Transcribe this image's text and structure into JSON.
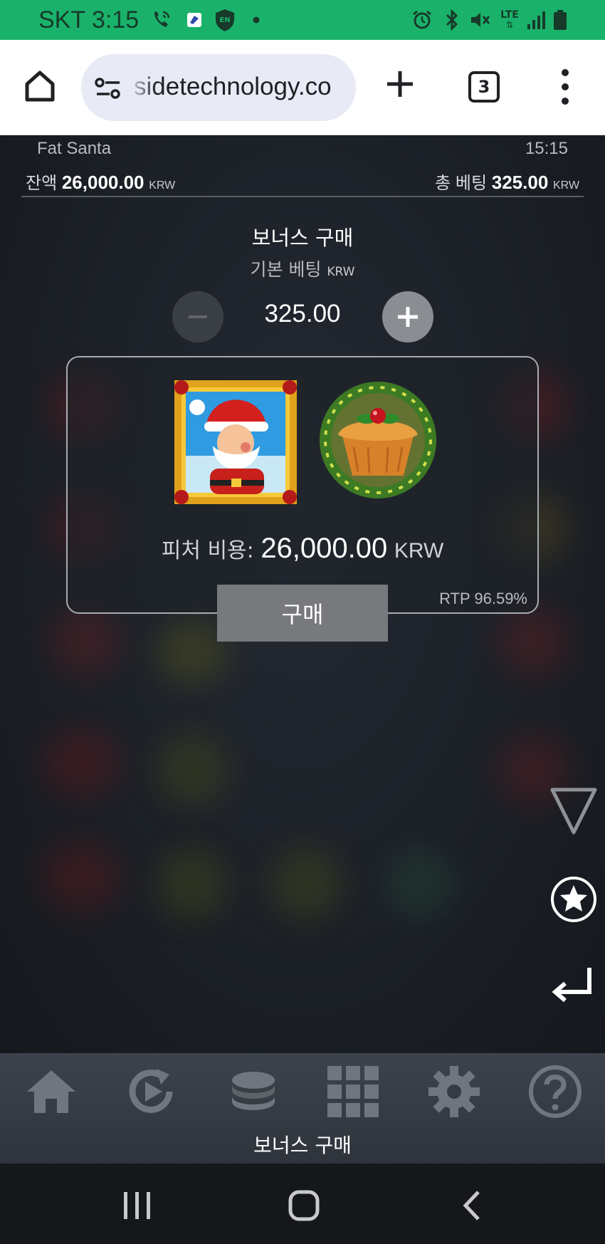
{
  "status_bar": {
    "carrier_time": "SKT 3:15",
    "icons": [
      "wifi-call-icon",
      "app-icon",
      "vpn-shield-icon",
      "dot-icon",
      "alarm-icon",
      "bluetooth-icon",
      "mute-icon",
      "lte-icon",
      "signal-icon",
      "battery-icon"
    ],
    "shield_text": "EN",
    "lte_text": "LTE"
  },
  "browser": {
    "url": "sidetechnology.co",
    "tab_count": "3"
  },
  "game": {
    "title": "Fat Santa",
    "time": "15:15",
    "balance_label": "잔액",
    "balance_value": "26,000.00",
    "balance_unit": "KRW",
    "total_bet_label": "총 베팅",
    "total_bet_value": "325.00",
    "total_bet_unit": "KRW"
  },
  "bonus_buy": {
    "title": "보너스 구매",
    "base_bet_label": "기본 베팅",
    "base_bet_unit": "KRW",
    "bet_value": "325.00",
    "feature_cost_label": "피처 비용:",
    "feature_cost_value": "26,000.00",
    "feature_cost_unit": "KRW",
    "rtp": "RTP 96.59%",
    "buy_label": "구매"
  },
  "toolbar": {
    "icons": [
      "home-icon",
      "autoplay-icon",
      "coins-icon",
      "grid-icon",
      "settings-icon",
      "help-icon"
    ],
    "label": "보너스 구매"
  },
  "colors": {
    "status_green": "#1ab26b",
    "game_bg": "#1b1f26",
    "buy_button": "#77797d"
  }
}
